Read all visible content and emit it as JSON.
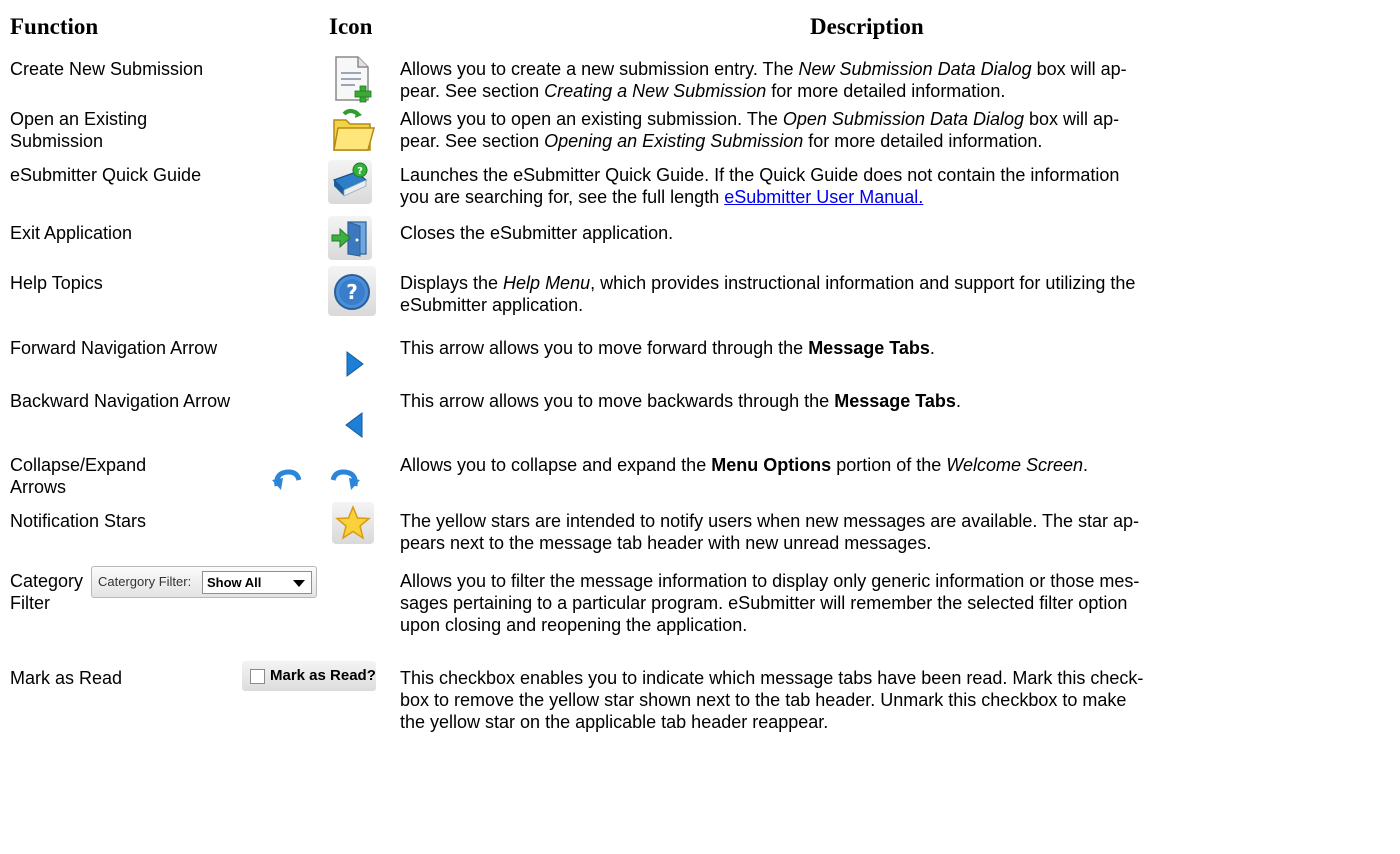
{
  "headers": {
    "function": "Function",
    "icon": "Icon",
    "description": "Description"
  },
  "rows": [
    {
      "function": "Create New Submission",
      "icon": "new-document-icon",
      "description": [
        {
          "t": "Allows you to create a new submission entry.  The "
        },
        {
          "t": "New Submission Data Dialog",
          "i": true
        },
        {
          "t": " box will ap-\npear.  See section "
        },
        {
          "t": "Creating a New Submission",
          "i": true
        },
        {
          "t": " for more detailed information."
        }
      ]
    },
    {
      "function": "Open an Existing\nSubmission",
      "icon": "open-folder-icon",
      "description": [
        {
          "t": "Allows you to open an existing submission.  The "
        },
        {
          "t": "Open Submission Data Dialog",
          "i": true
        },
        {
          "t": " box will ap-\npear.  See section "
        },
        {
          "t": "Opening an Existing Submission",
          "i": true
        },
        {
          "t": " for more detailed information."
        }
      ]
    },
    {
      "function": "eSubmitter Quick Guide",
      "icon": "quick-guide-book-icon",
      "description": [
        {
          "t": "Launches the eSubmitter Quick Guide.  If the Quick Guide does not contain the information\nyou are searching for, see the full length "
        },
        {
          "t": "eSubmitter User Manual.",
          "link": true
        }
      ]
    },
    {
      "function": "Exit Application",
      "icon": "exit-door-icon",
      "description": [
        {
          "t": "Closes the eSubmitter application."
        }
      ]
    },
    {
      "function": "Help Topics",
      "icon": "help-question-icon",
      "description": [
        {
          "t": "Displays the "
        },
        {
          "t": "Help Menu",
          "i": true
        },
        {
          "t": ", which provides instructional information and support for utilizing the\neSubmitter application."
        }
      ]
    },
    {
      "function": "Forward Navigation Arrow",
      "icon": "forward-arrow-icon",
      "description": [
        {
          "t": "This arrow allows you to move forward through the "
        },
        {
          "t": "Message Tabs",
          "b": true
        },
        {
          "t": "."
        }
      ]
    },
    {
      "function": "Backward Navigation Arrow",
      "icon": "backward-arrow-icon",
      "description": [
        {
          "t": "This arrow allows you to move backwards through the "
        },
        {
          "t": "Message Tabs",
          "b": true
        },
        {
          "t": "."
        }
      ]
    },
    {
      "function": "Collapse/Expand\nArrows",
      "icon": "collapse-expand-arrows-icon",
      "description": [
        {
          "t": "Allows you to collapse and expand the "
        },
        {
          "t": "Menu Options",
          "b": true
        },
        {
          "t": " portion of the "
        },
        {
          "t": "Welcome Screen",
          "i": true
        },
        {
          "t": "."
        }
      ]
    },
    {
      "function": "Notification Stars",
      "icon": "star-icon",
      "description": [
        {
          "t": "The yellow stars are intended to notify users when new messages are available.  The star ap-\npears next to the message tab header with new unread messages."
        }
      ]
    },
    {
      "function": "Category\nFilter",
      "icon": "category-filter-combo",
      "description": [
        {
          "t": "Allows you to filter the message information to display only generic information or those mes-\nsages pertaining to a particular program.  eSubmitter will remember the selected filter option\nupon closing and reopening the application."
        }
      ]
    },
    {
      "function": "Mark as Read",
      "icon": "mark-as-read-checkbox",
      "description": [
        {
          "t": "This checkbox enables you to indicate which message tabs have been read.  Mark this check-\nbox to remove the yellow star shown next to the tab header.  Unmark this checkbox to make\nthe yellow star on the applicable tab header reappear."
        }
      ]
    }
  ],
  "category_filter": {
    "label": "Catergory Filter:",
    "selected": "Show All"
  },
  "mark_as_read": {
    "label": "Mark as Read?",
    "checked": false
  },
  "colors": {
    "link": "#0000ee",
    "star": "#f5c400",
    "arrow_blue": "#1e7fd6"
  }
}
